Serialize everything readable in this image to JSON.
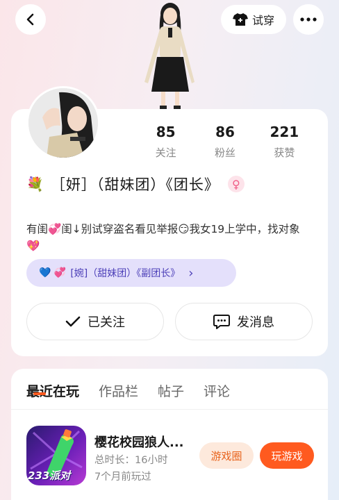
{
  "header": {
    "back_icon": "chevron-left-icon",
    "tryon_label": "试穿",
    "tryon_icon": "shirt-icon",
    "more_icon": "more-dots-icon"
  },
  "profile": {
    "stats": [
      {
        "value": "85",
        "label": "关注"
      },
      {
        "value": "86",
        "label": "粉丝"
      },
      {
        "value": "221",
        "label": "获赞"
      }
    ],
    "name_emoji": "💐",
    "name": "［妍］（甜妹团）《团长》",
    "gender_symbol": "♀",
    "bio": "有闺💞闺↓别试穿盗名看见举报😏我女19上学中，找对象💖",
    "relation": {
      "hearts": "💙 💞",
      "label": "[婉]（甜妹团）《副团长》",
      "arrow": "›"
    },
    "follow_label": "已关注",
    "message_label": "发消息"
  },
  "tabs": [
    {
      "label": "最近在玩",
      "active": true
    },
    {
      "label": "作品栏",
      "active": false
    },
    {
      "label": "帖子",
      "active": false
    },
    {
      "label": "评论",
      "active": false
    }
  ],
  "game": {
    "title": "樱花校园狼人...",
    "duration": "总时长：16小时",
    "last_played": "7个月前玩过",
    "icon_text": "233派对",
    "circle_label": "游戏圈",
    "play_label": "玩游戏"
  },
  "colors": {
    "accent": "#ff5a1f",
    "relation_bg": "#e4e0fb",
    "relation_text": "#4c3fb8",
    "circle_bg": "#fde9dc"
  }
}
